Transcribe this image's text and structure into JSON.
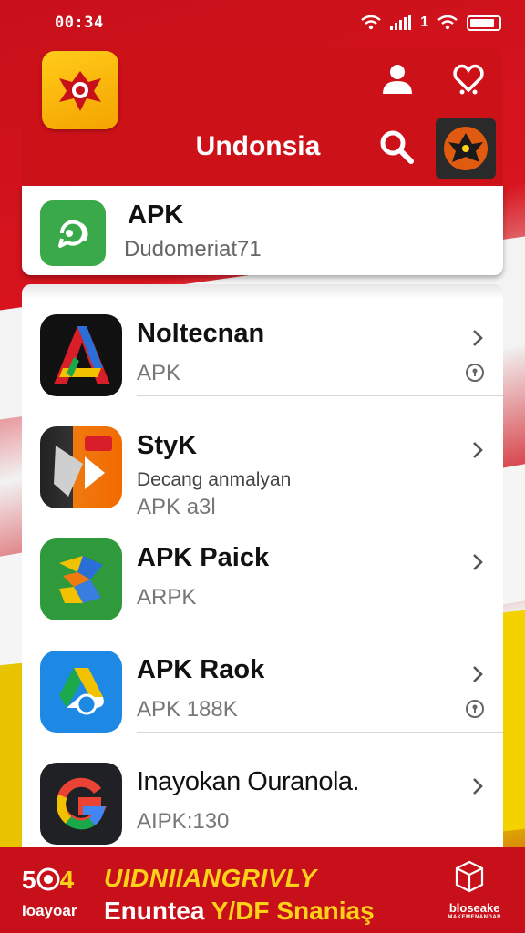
{
  "status_bar": {
    "time": "00:34",
    "indicator": "1"
  },
  "header": {
    "title": "Undonsia"
  },
  "featured": {
    "title": "APK",
    "subtitle": "Dudomeriat71"
  },
  "apps": [
    {
      "title": "Noltecnan",
      "subtitle": "APK",
      "icon": "letter-a-icon"
    },
    {
      "title": "StyK",
      "description": "Decang anmalyan",
      "subtitle": "APK a3l",
      "icon": "play-icon"
    },
    {
      "title": "APK Paick",
      "subtitle": "ARPK",
      "icon": "puzzle-icon"
    },
    {
      "title": "APK Raok",
      "subtitle": "APK 188K",
      "icon": "drive-icon"
    },
    {
      "title": "Inayokan Ouranola.",
      "subtitle": "AIPK:130",
      "icon": "g-icon"
    }
  ],
  "banner": {
    "logo_number": "5",
    "logo_suffix": "4",
    "logo_sub": "Ioayoar",
    "headline": "UIDNIIANGRIVLY",
    "line_start": "Enuntea",
    "line_highlight": "Y/DF",
    "line_end": "Snaniaş",
    "tag_top": "bloseake",
    "tag_bottom": "MAKEMENANDAR"
  },
  "colors": {
    "brand_red": "#cd1119",
    "accent_yellow": "#ffd21a",
    "featured_green": "#39a94a"
  }
}
